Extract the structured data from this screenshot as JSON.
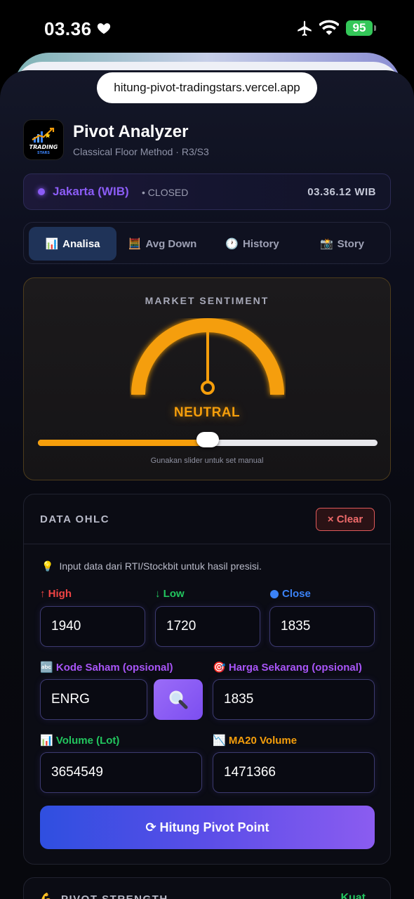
{
  "status_bar": {
    "time": "03.36",
    "battery": "95"
  },
  "browser": {
    "url": "hitung-pivot-tradingstars.vercel.app"
  },
  "header": {
    "title": "Pivot Analyzer",
    "subtitle": "Classical Floor Method · R3/S3",
    "logo_text": "TRADING STARS"
  },
  "market": {
    "city": "Jakarta (WIB)",
    "state": "• CLOSED",
    "clock": "03.36.12 WIB"
  },
  "tabs": [
    {
      "icon": "📊",
      "label": "Analisa",
      "active": true
    },
    {
      "icon": "🧮",
      "label": "Avg Down",
      "active": false
    },
    {
      "icon": "🕐",
      "label": "History",
      "active": false
    },
    {
      "icon": "📸",
      "label": "Story",
      "active": false
    }
  ],
  "sentiment": {
    "title": "MARKET SENTIMENT",
    "label": "NEUTRAL",
    "level": 0.5,
    "hint": "Gunakan slider untuk set manual",
    "color": "#f59e0b"
  },
  "ohlc": {
    "title": "DATA OHLC",
    "clear_label": "× Clear",
    "tip": "Input data dari RTI/Stockbit untuk hasil presisi.",
    "high": {
      "label": "↑ High",
      "value": "1940",
      "color": "#ef4444"
    },
    "low": {
      "label": "↓ Low",
      "value": "1720",
      "color": "#22c55e"
    },
    "close": {
      "label": "Close",
      "value": "1835",
      "color": "#3b82f6"
    },
    "ticker": {
      "icon": "🔤",
      "label": "Kode Saham (opsional)",
      "value": "ENRG"
    },
    "price": {
      "icon": "🎯",
      "label": "Harga Sekarang (opsional)",
      "value": "1835"
    },
    "volume": {
      "icon": "📊",
      "label": "Volume (Lot)",
      "value": "3654549"
    },
    "ma20": {
      "icon": "📉",
      "label": "MA20 Volume",
      "value": "1471366"
    },
    "calc_label": "⟳ Hitung Pivot Point"
  },
  "strength": {
    "title": "PIVOT STRENGTH",
    "value": "Kuat"
  }
}
